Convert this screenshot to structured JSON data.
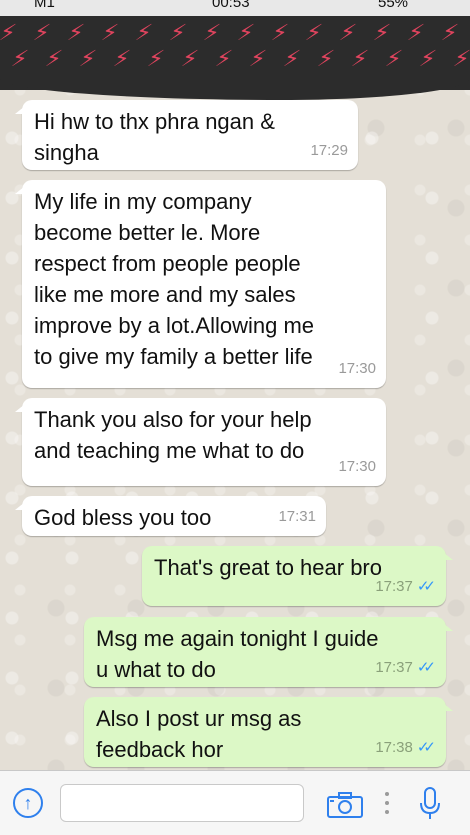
{
  "status_bar": {
    "carrier": "M1",
    "time": "00:53",
    "battery": "55%"
  },
  "messages": [
    {
      "direction": "in",
      "text": "Hi hw to thx phra ngan &\nsingha",
      "time": "17:29"
    },
    {
      "direction": "in",
      "text": "My life in my company\nbecome better le. More\nrespect from people people\nlike me more and my sales\nimprove by a lot.Allowing me\nto give my family a better life",
      "time": "17:30"
    },
    {
      "direction": "in",
      "text": "Thank you also for your help\nand teaching me what to do",
      "time": "17:30"
    },
    {
      "direction": "in",
      "text": "God bless you too",
      "time": "17:31"
    },
    {
      "direction": "out",
      "text": "That's great to hear bro",
      "time": "17:37",
      "read_ticks": "✓✓"
    },
    {
      "direction": "out",
      "text": "Msg me again tonight I guide\nu what to do",
      "time": "17:37",
      "read_ticks": "✓✓"
    },
    {
      "direction": "out",
      "text": "Also I post ur msg as\nfeedback hor",
      "time": "17:38",
      "read_ticks": "✓✓"
    }
  ],
  "input_bar": {
    "message_value": "",
    "icons": [
      "upload-arrow-icon",
      "camera-icon",
      "more-dots-icon",
      "microphone-icon"
    ]
  },
  "colors": {
    "incoming_bubble": "#ffffff",
    "outgoing_bubble": "#dcf8c6",
    "read_ticks": "#3497f9",
    "accent": "#2f80ed",
    "redaction_bolt": "#e0445e"
  }
}
